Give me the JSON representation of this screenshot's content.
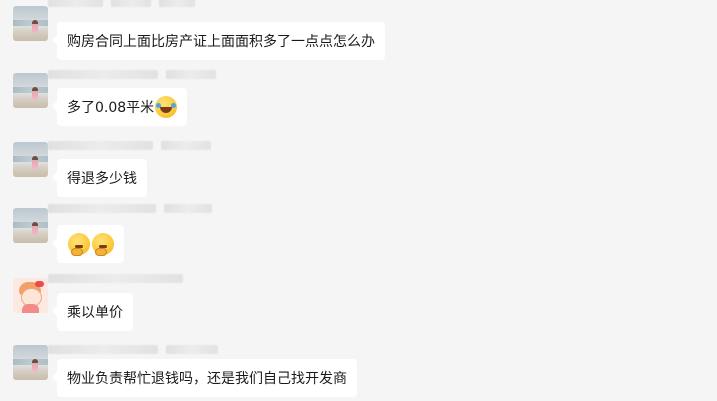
{
  "messages": [
    {
      "avatar": "beach-photo",
      "text": "购房合同上面比房产证上面面积多了一点点怎么办",
      "emojis": []
    },
    {
      "avatar": "beach-photo",
      "text": "多了0.08平米",
      "emojis": [
        "laughing-crying-emoji"
      ]
    },
    {
      "avatar": "beach-photo",
      "text": "得退多少钱",
      "emojis": []
    },
    {
      "avatar": "beach-photo",
      "text": "",
      "emojis": [
        "thinking-emoji",
        "thinking-emoji"
      ]
    },
    {
      "avatar": "cartoon-girl",
      "text": "乘以单价",
      "emojis": []
    },
    {
      "avatar": "beach-photo",
      "text": "物业负责帮忙退钱吗，还是我们自己找开发商",
      "emojis": []
    }
  ],
  "colors": {
    "background": "#f5f5f5",
    "bubble": "#ffffff",
    "text": "#1a1a1a"
  }
}
